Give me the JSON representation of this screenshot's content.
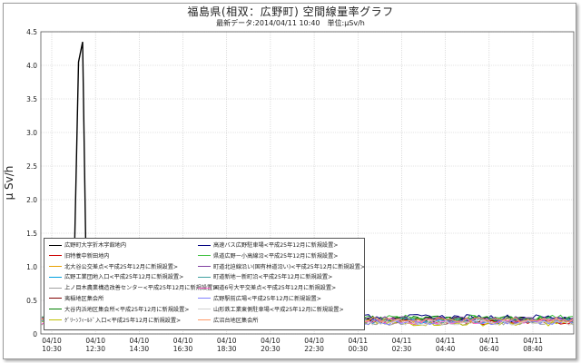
{
  "header": {
    "title": "福島県(相双：広野町) 空間線量率グラフ",
    "subtitle": "最新データ:2014/04/11 10:40　単位:μSv/h"
  },
  "chart_data": {
    "type": "line",
    "ylabel": "μ Sv/h",
    "xlabel": "",
    "ylim": [
      0,
      4.5
    ],
    "yticks": [
      "0",
      "0.5",
      "1.0",
      "1.5",
      "2.0",
      "2.5",
      "3.0",
      "3.5",
      "4.0",
      "4.5"
    ],
    "xticks": [
      {
        "date": "04/10",
        "time": "10:30"
      },
      {
        "date": "04/10",
        "time": "12:30"
      },
      {
        "date": "04/10",
        "time": "14:30"
      },
      {
        "date": "04/10",
        "time": "16:30"
      },
      {
        "date": "04/10",
        "time": "18:30"
      },
      {
        "date": "04/10",
        "time": "20:30"
      },
      {
        "date": "04/10",
        "time": "22:30"
      },
      {
        "date": "04/11",
        "time": "00:30"
      },
      {
        "date": "04/11",
        "time": "02:30"
      },
      {
        "date": "04/11",
        "time": "04:40"
      },
      {
        "date": "04/11",
        "time": "06:40"
      },
      {
        "date": "04/11",
        "time": "08:40"
      }
    ],
    "grid": true,
    "legend_position": "bottom-left",
    "series": [
      {
        "name": "広野町大字折木字舘地内",
        "color": "#000000",
        "spike": true,
        "base": 0.22,
        "spike_peak": 4.35
      },
      {
        "name": "旧特養中新田地内",
        "color": "#cc0000",
        "base": 0.18
      },
      {
        "name": "北大谷公交差点<平成25年12月に新規設置>",
        "color": "#e8a000",
        "base": 0.2
      },
      {
        "name": "広野工業団地入口<平成25年12月に新規設置>",
        "color": "#00a0e0",
        "base": 0.19
      },
      {
        "name": "上ノ目木農業構造改善センター<平成25年12月に新規設置>",
        "color": "#a0a0a0",
        "base": 0.17
      },
      {
        "name": "夷稲地区集会所",
        "color": "#800000",
        "base": 0.21
      },
      {
        "name": "大谷内浜地区集会所<平成25年12月に新規設置>",
        "color": "#008000",
        "base": 0.23
      },
      {
        "name": "ｸﾞﾘｰﾝﾌｨｰﾙﾄﾞ入口<平成25年12月に新規設置>",
        "color": "#c0c000",
        "base": 0.16
      },
      {
        "name": "高速バス広野駐車場<平成25年12月に新規設置>",
        "color": "#000080",
        "base": 0.25
      },
      {
        "name": "県道広野ー小高線沿<平成25年12月に新規設置>",
        "color": "#40c040",
        "base": 0.24
      },
      {
        "name": "町道北迫線沿い(国有林道沿い)<平成25年12月に新規設置>",
        "color": "#8040a0",
        "base": 0.22
      },
      {
        "name": "町道新地ー新町沿<平成25年12月に新規設置>",
        "color": "#40a0a0",
        "base": 0.2
      },
      {
        "name": "国道6号大平交差点<平成25年12月に新規設置>",
        "color": "#ff66cc",
        "base": 0.19
      },
      {
        "name": "広野駅前広場<平成25年12月に新規設置>",
        "color": "#8080ff",
        "base": 0.18
      },
      {
        "name": "山形鉄工業東側駐車場<平成25年12月に新規設置>",
        "color": "#d0d0d0",
        "base": 0.17
      },
      {
        "name": "広沼台地区集会所",
        "color": "#ff9966",
        "base": 0.21
      }
    ]
  }
}
